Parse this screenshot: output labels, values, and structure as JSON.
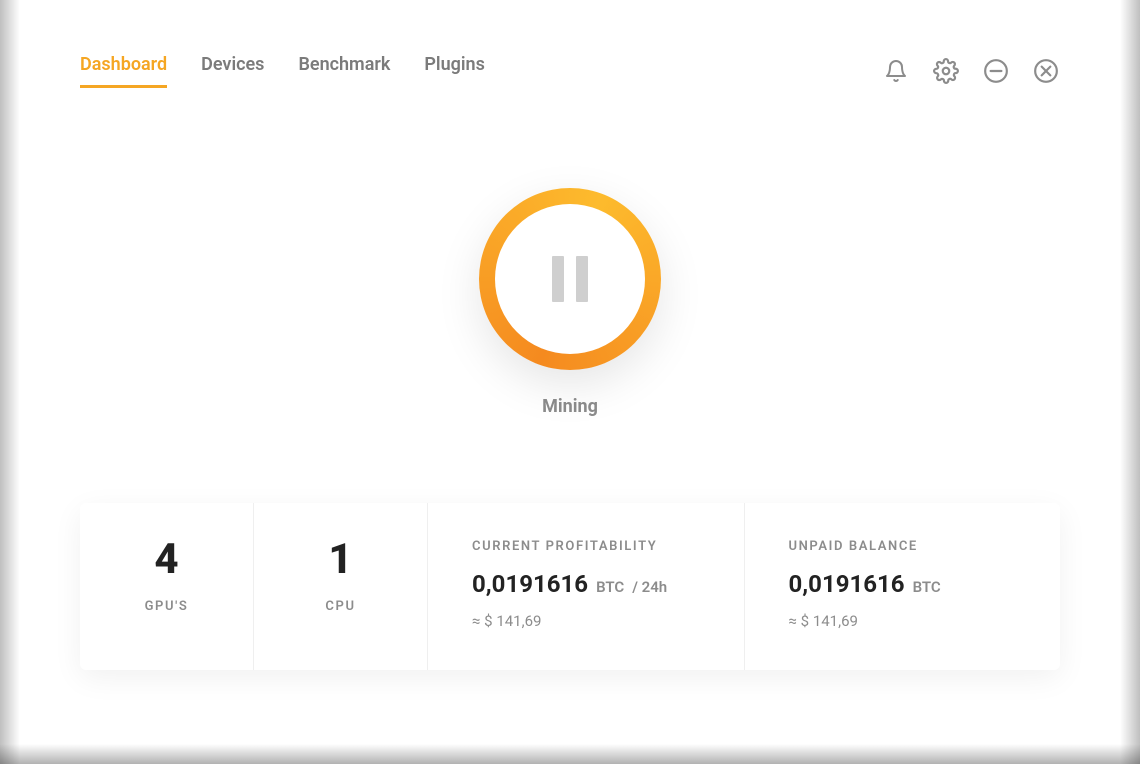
{
  "colors": {
    "accent": "#f5a623",
    "accent_dark": "#f58a1f",
    "accent_light": "#fdbb2d",
    "text_muted": "#8c8c8c",
    "text": "#222222"
  },
  "nav": {
    "tabs": [
      {
        "label": "Dashboard",
        "active": true
      },
      {
        "label": "Devices",
        "active": false
      },
      {
        "label": "Benchmark",
        "active": false
      },
      {
        "label": "Plugins",
        "active": false
      }
    ],
    "window_icons": [
      "bell-icon",
      "gear-icon",
      "minimize-icon",
      "close-icon"
    ]
  },
  "mining": {
    "status_label": "Mining",
    "state_icon": "pause-icon"
  },
  "stats": {
    "gpus": {
      "value": "4",
      "label": "GPU'S"
    },
    "cpu": {
      "value": "1",
      "label": "CPU"
    },
    "profitability": {
      "section_label": "CURRENT PROFITABILITY",
      "value": "0,0191616",
      "unit": "BTC",
      "per": "/ 24h",
      "approx": "≈ $ 141,69"
    },
    "balance": {
      "section_label": "UNPAID BALANCE",
      "value": "0,0191616",
      "unit": "BTC",
      "approx": "≈ $ 141,69"
    }
  }
}
